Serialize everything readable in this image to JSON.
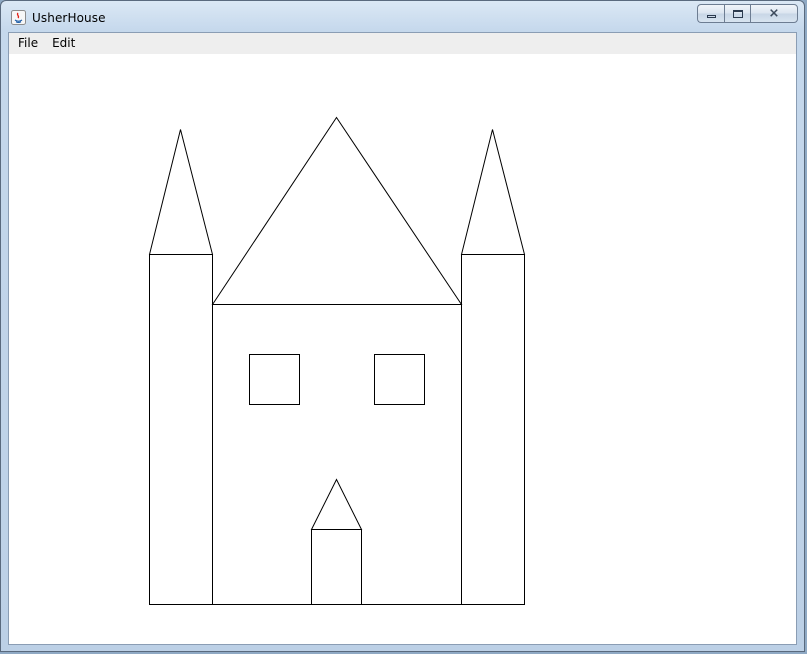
{
  "window": {
    "title": "UsherHouse",
    "controls": {
      "minimize_icon": "minimize-icon",
      "maximize_icon": "maximize-icon",
      "close_glyph": "⨯"
    }
  },
  "menubar": {
    "items": [
      {
        "label": "File"
      },
      {
        "label": "Edit"
      }
    ]
  },
  "drawing": {
    "subject": "house",
    "stroke_color": "#000000",
    "fill_color": "#ffffff"
  }
}
